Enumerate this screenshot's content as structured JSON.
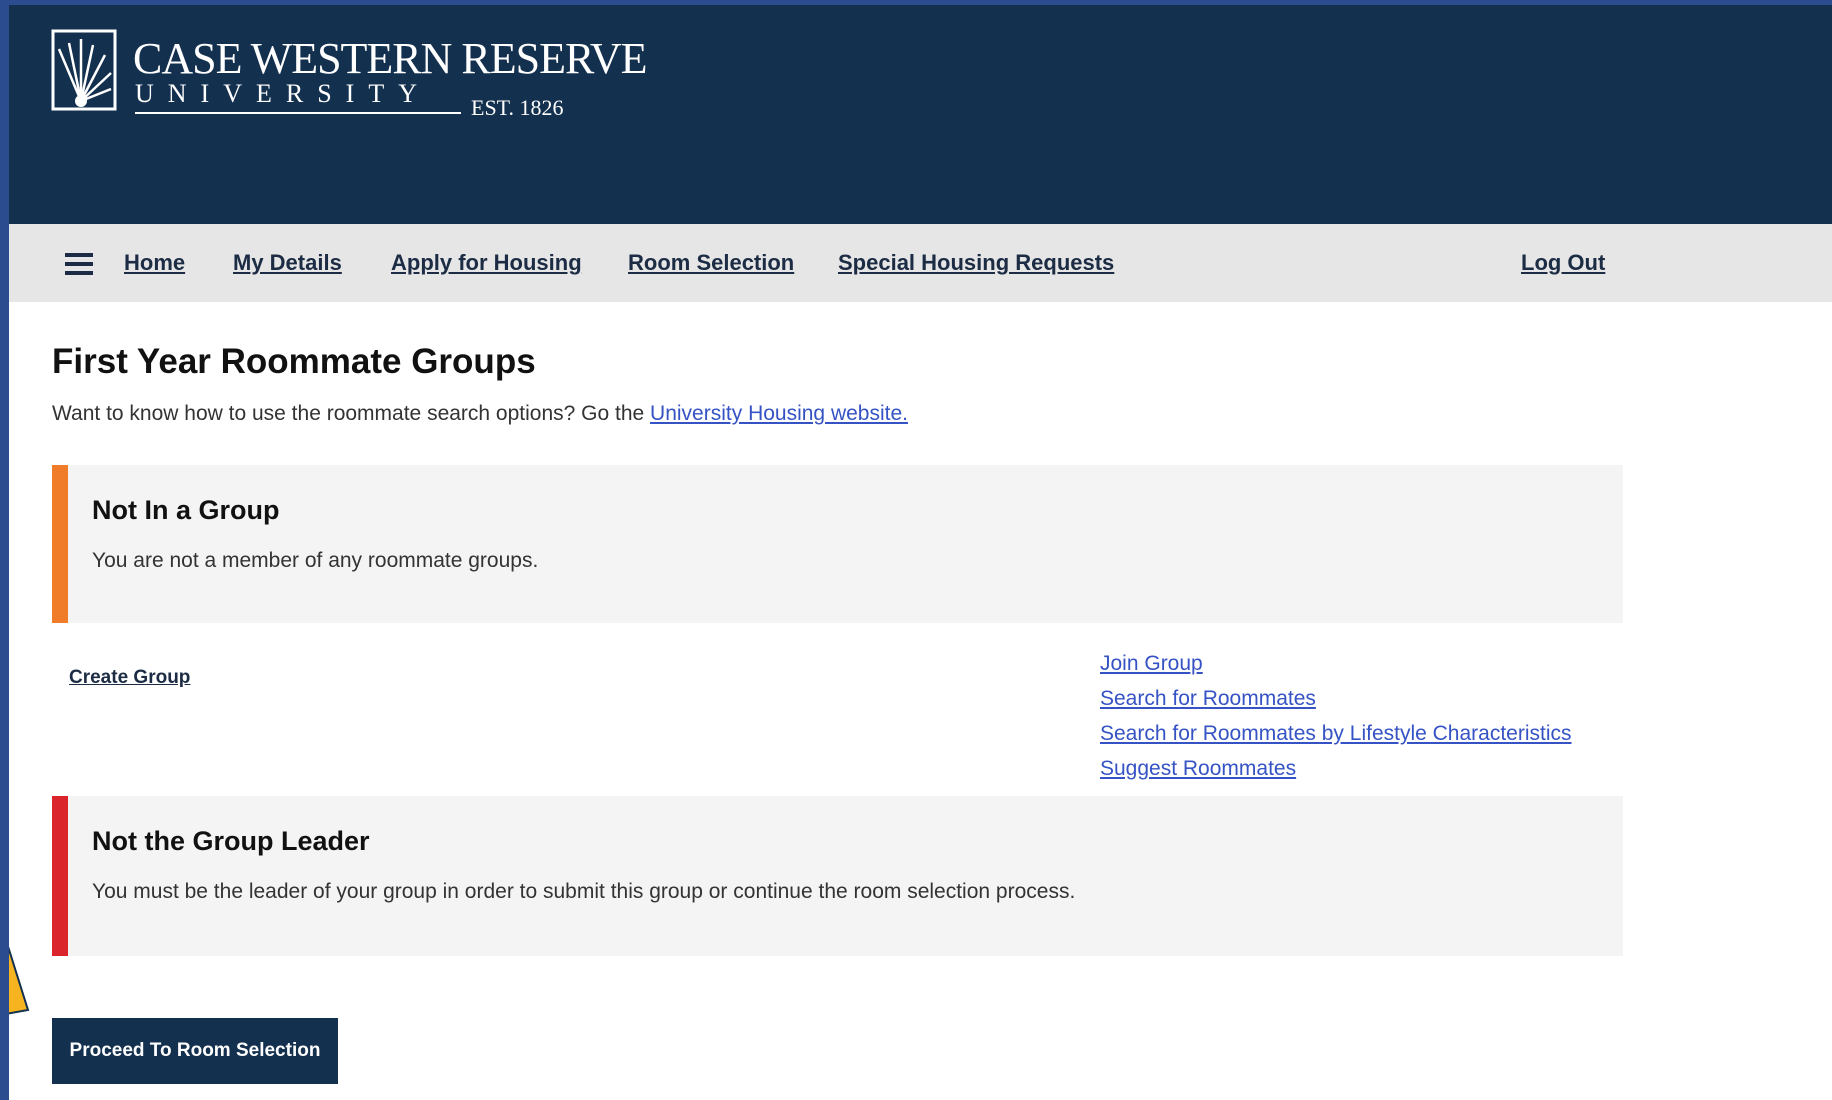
{
  "colors": {
    "brand_navy": "#14304f",
    "nav_bg": "#e6e6e6",
    "link_blue": "#3553c4",
    "alert_info_accent": "#f07c2a",
    "alert_error_accent": "#d9252b",
    "outer_frame": "#2b4d8f",
    "annotation_arrow": "#f6b520"
  },
  "header": {
    "logo": {
      "icon": "cwru-logo-icon",
      "name": "CASE WESTERN RESERVE",
      "subtitle": "UNIVERSITY",
      "established": "EST. 1826"
    }
  },
  "nav": {
    "menu_icon": "hamburger-menu-icon",
    "items": [
      {
        "label": "Home"
      },
      {
        "label": "My Details"
      },
      {
        "label": "Apply for Housing"
      },
      {
        "label": "Room Selection"
      },
      {
        "label": "Special Housing Requests"
      }
    ],
    "logout_label": "Log Out"
  },
  "main": {
    "title": "First Year Roommate Groups",
    "intro_text": "Want to know how to use the roommate search options? Go the ",
    "intro_link": "University Housing website."
  },
  "alerts": [
    {
      "title": "Not In a Group",
      "message": "You are not a member of any roommate groups."
    },
    {
      "title": "Not the Group Leader",
      "message": "You must be the leader of your group in order to submit this group or continue the room selection process."
    }
  ],
  "actions": {
    "create_group": "Create Group",
    "links": [
      {
        "label": "Join Group"
      },
      {
        "label": "Search for Roommates"
      },
      {
        "label": "Search for Roommates by Lifestyle Characteristics"
      },
      {
        "label": "Suggest Roommates"
      }
    ]
  },
  "proceed_button": "Proceed To Room Selection",
  "annotation": {
    "icon": "pointer-arrow-icon"
  }
}
